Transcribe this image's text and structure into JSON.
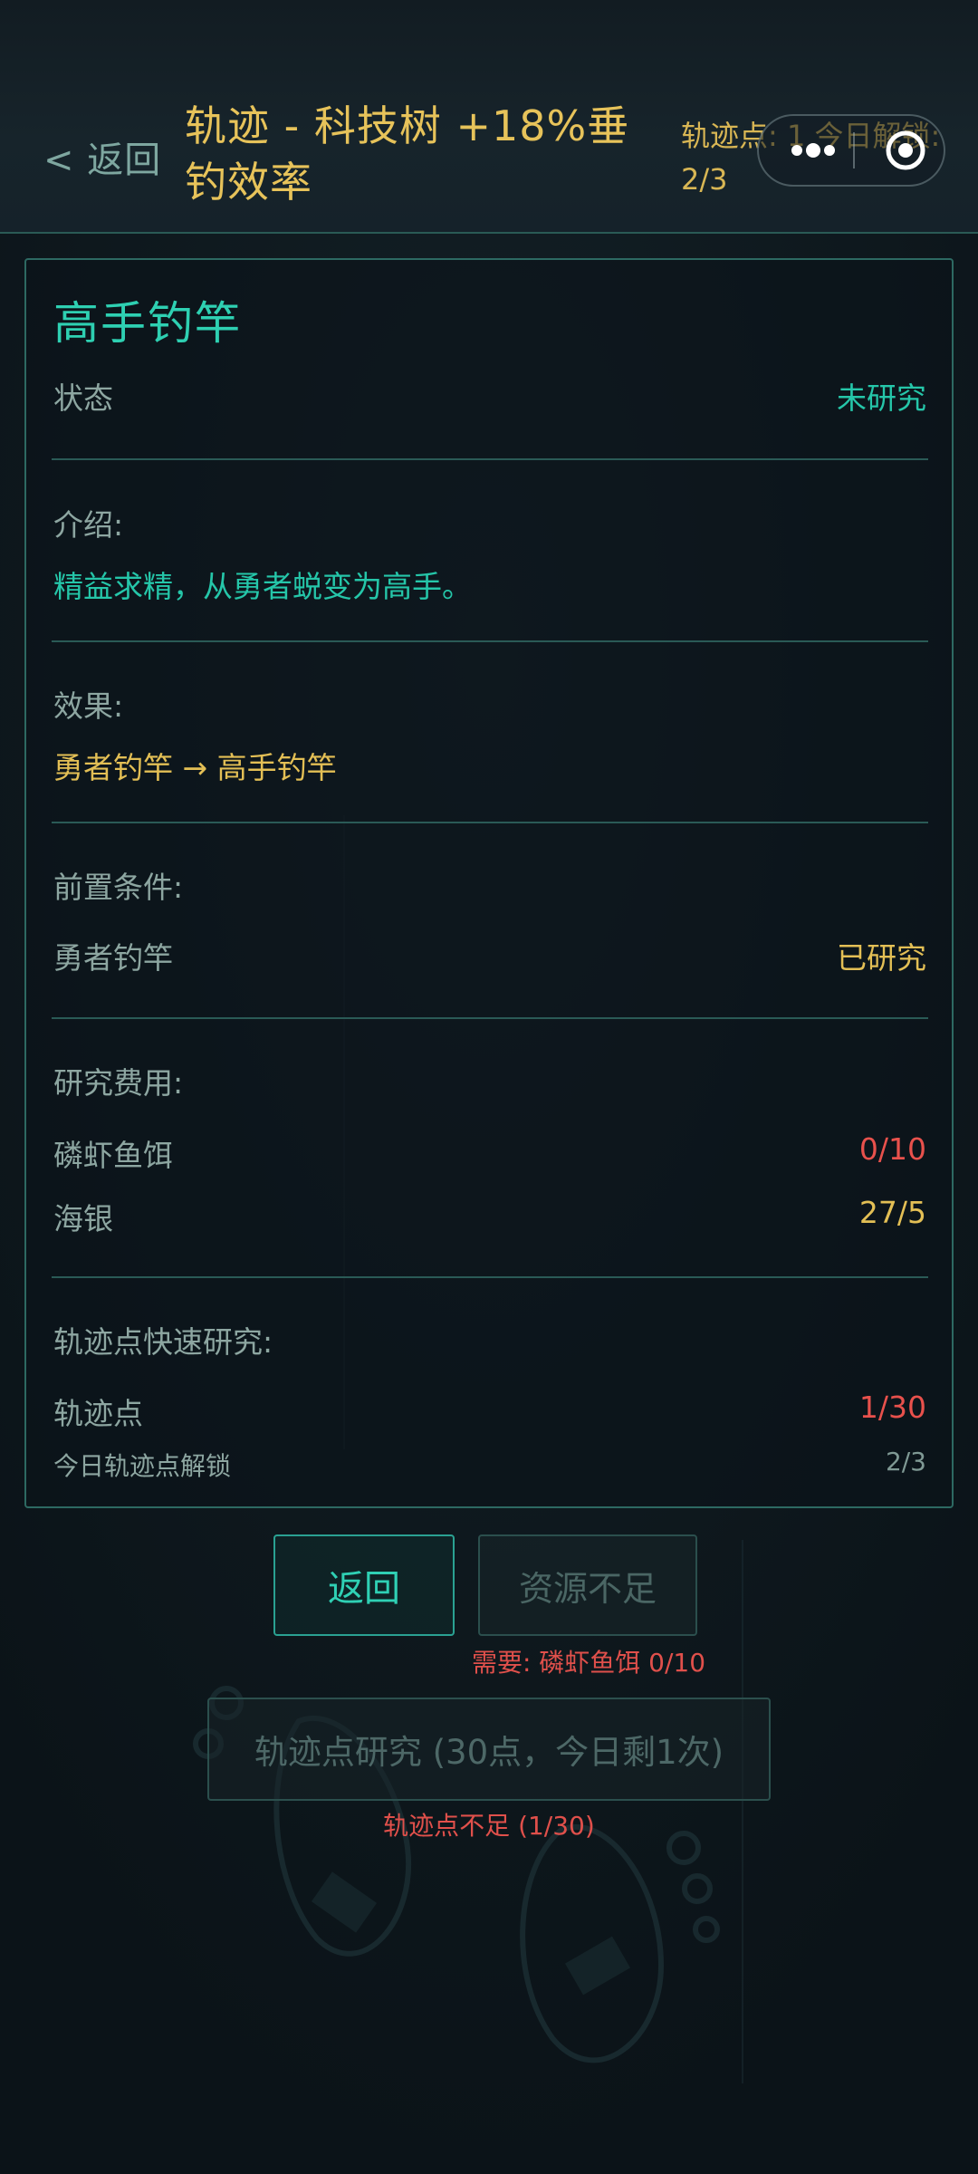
{
  "header": {
    "back_label": "< 返回",
    "title": "轨迹 - 科技树  +18%垂钓效率",
    "trace_points_label": "轨迹点: 1  今日解锁: 2/3"
  },
  "card": {
    "title": "高手钓竿",
    "status": {
      "label": "状态",
      "value": "未研究"
    },
    "intro": {
      "label": "介绍:",
      "text": "精益求精，从勇者蜕变为高手。"
    },
    "effect": {
      "label": "效果:",
      "text": "勇者钓竿 → 高手钓竿"
    },
    "prereq": {
      "label": "前置条件:",
      "item": "勇者钓竿",
      "value": "已研究"
    },
    "cost": {
      "label": "研究费用:",
      "items": [
        {
          "name": "磷虾鱼饵",
          "value": "0/10"
        },
        {
          "name": "海银",
          "value": "27/5"
        }
      ]
    },
    "quick": {
      "label": "轨迹点快速研究:",
      "points_name": "轨迹点",
      "points_value": "1/30",
      "unlock_name": "今日轨迹点解锁",
      "unlock_value": "2/3"
    }
  },
  "buttons": {
    "back": "返回",
    "insufficient": "资源不足",
    "need_text": "需要: 磷虾鱼饵 0/10",
    "trace_research": "轨迹点研究 (30点，今日剩1次)",
    "trace_insufficient": "轨迹点不足 (1/30)"
  },
  "colors": {
    "accent_teal": "#25c6a9",
    "gold": "#e3bf55",
    "red": "#e8514c",
    "background": "#0e171d"
  },
  "icons": {
    "more": "more-dots-icon",
    "close": "target-close-icon"
  }
}
